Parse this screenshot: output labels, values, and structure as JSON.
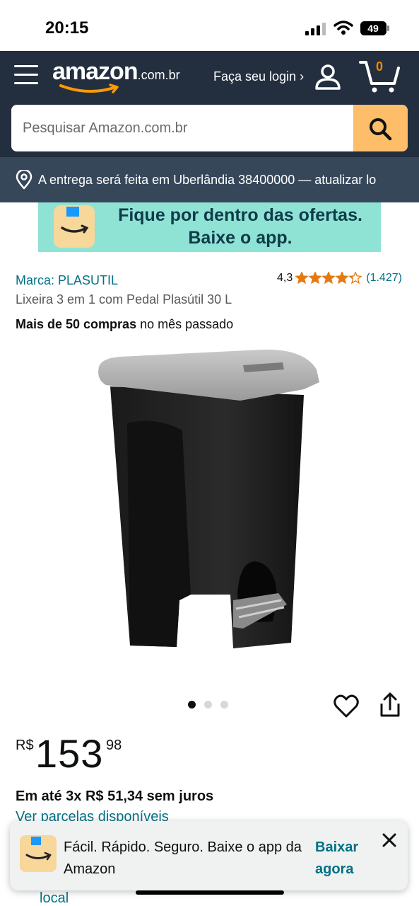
{
  "status_bar": {
    "time": "20:15",
    "battery": "49"
  },
  "header": {
    "logo_word": "amazon",
    "logo_tld": ".com.br",
    "login_label": "Faça seu login ›",
    "cart_count": "0"
  },
  "search": {
    "placeholder": "Pesquisar Amazon.com.br"
  },
  "delivery": {
    "text": "A entrega será feita em Uberlândia 38400000 — atualizar lo"
  },
  "banner": {
    "line1": "Fique por dentro das ofertas.",
    "line2": "Baixe o app."
  },
  "product": {
    "brand": "Marca: PLASUTIL",
    "rating_value": "4,3",
    "rating_stars": 4.3,
    "rating_count": "(1.427)",
    "title": "Lixeira 3 em 1 com Pedal Plasútil 30 L",
    "purchases_bold": "Mais de 50 compras",
    "purchases_rest": " no mês passado",
    "image_count": 3,
    "image_index": 1
  },
  "price": {
    "currency": "R$",
    "integer": "153",
    "cents": "98",
    "installments": "Em até 3x R$ 51,34 sem juros",
    "installments_link": "Ver parcelas disponíveis",
    "local_link": "local"
  },
  "popup": {
    "message": "Fácil. Rápido. Seguro. Baixe o app da Amazon",
    "cta": "Baixar agora"
  },
  "colors": {
    "header_bg": "#232f3e",
    "delivery_bg": "#37475a",
    "search_button": "#febd69",
    "banner_bg": "#8fe3d4",
    "link": "#007185",
    "star": "#e47911"
  },
  "icons": [
    "menu-icon",
    "user-icon",
    "cart-icon",
    "search-icon",
    "location-pin-icon",
    "heart-icon",
    "share-icon",
    "close-icon"
  ]
}
